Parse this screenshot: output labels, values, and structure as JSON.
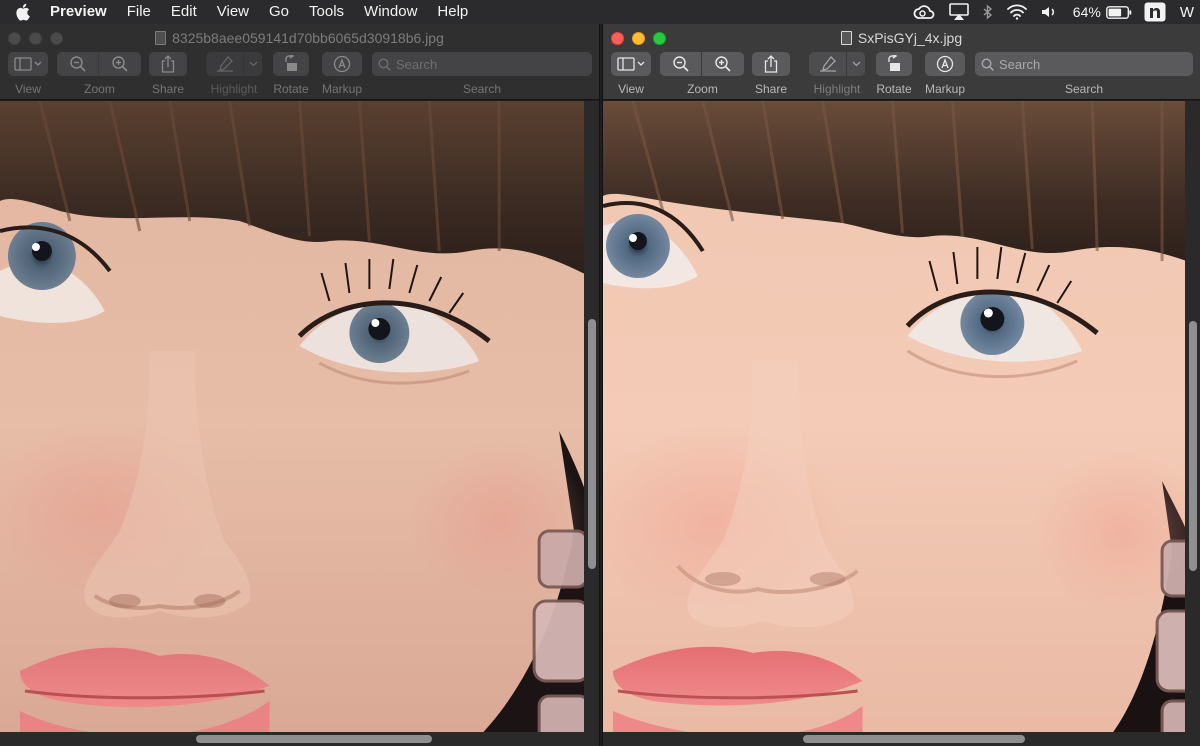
{
  "menubar": {
    "apple_icon": "apple-logo-icon",
    "items": [
      "Preview",
      "File",
      "Edit",
      "View",
      "Go",
      "Tools",
      "Window",
      "Help"
    ],
    "status": {
      "icons": [
        "creative-cloud-icon",
        "airplay-icon",
        "bluetooth-icon",
        "wifi-icon",
        "volume-icon"
      ],
      "battery_percent": "64%",
      "user_initial": "W"
    }
  },
  "windows": {
    "left": {
      "title": "8325b8aee059141d70bb6065d30918b6.jpg",
      "state": "inactive"
    },
    "right": {
      "title": "SxPisGYj_4x.jpg",
      "state": "active"
    }
  },
  "toolbar": {
    "view_label": "View",
    "zoom_label": "Zoom",
    "share_label": "Share",
    "highlight_label": "Highlight",
    "rotate_label": "Rotate",
    "markup_label": "Markup",
    "search_label": "Search",
    "search_placeholder": "Search"
  },
  "colors": {
    "traffic_red": "#fe5f57",
    "traffic_yellow": "#febc2e",
    "traffic_green": "#28c840"
  }
}
